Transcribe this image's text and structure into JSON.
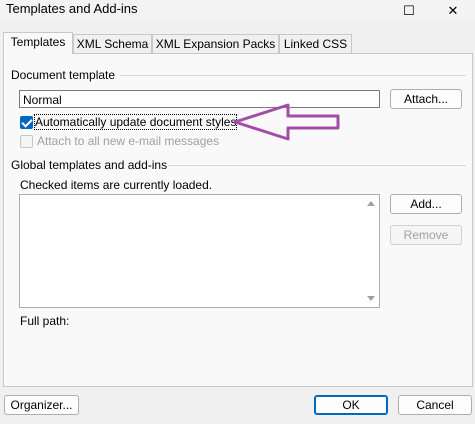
{
  "window": {
    "title": "Templates and Add-ins",
    "maximize_glyph": "☐",
    "close_glyph": "✕"
  },
  "tabs": [
    {
      "label": "Templates",
      "active": true
    },
    {
      "label": "XML Schema",
      "active": false
    },
    {
      "label": "XML Expansion Packs",
      "active": false
    },
    {
      "label": "Linked CSS",
      "active": false
    }
  ],
  "document_template": {
    "heading": "Document template",
    "value": "Normal",
    "attach_label": "Attach...",
    "auto_update_label": "Automatically update document styles",
    "auto_update_checked": true,
    "attach_email_label": "Attach to all new e-mail messages",
    "attach_email_checked": false
  },
  "global_templates": {
    "heading": "Global templates and add-ins",
    "subtext": "Checked items are currently loaded.",
    "items": [],
    "add_label": "Add...",
    "remove_label": "Remove"
  },
  "full_path_label": "Full path:",
  "footer": {
    "organizer_label": "Organizer...",
    "ok_label": "OK",
    "cancel_label": "Cancel"
  },
  "annotation": {
    "color": "#a34ea6",
    "icon": "left-arrow"
  }
}
